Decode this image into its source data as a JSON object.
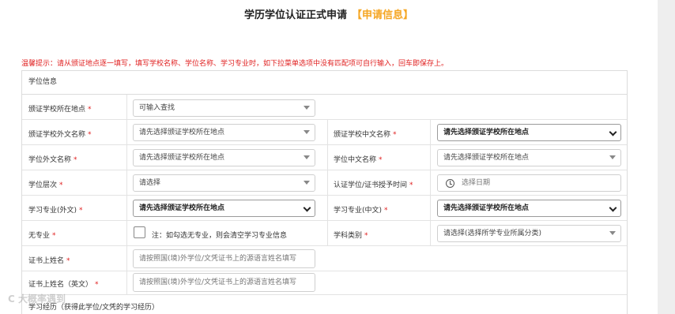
{
  "title": {
    "main": "学历学位认证正式申请",
    "sub": "【申请信息】"
  },
  "notice": "温馨提示：请从颁证地点逐一填写，填写学校名称、学位名称、学习专业时，如下拉菜单选项中没有匹配项可自行输入，回车即保存上。",
  "section": {
    "degree_info": "学位信息",
    "study_history": "学习经历（获得此学位/文凭的学习经历）"
  },
  "fields": {
    "school_location": {
      "label": "颁证学校所在地点",
      "required": "*",
      "value": "可输入查找"
    },
    "school_foreign_name": {
      "label": "颁证学校外文名称",
      "required": "*",
      "value": "请先选择颁证学校所在地点"
    },
    "school_chinese_name": {
      "label": "颁证学校中文名称",
      "required": "*",
      "value": "请先选择颁证学校所在地点"
    },
    "degree_foreign_name": {
      "label": "学位外文名称",
      "required": "*",
      "value": "请先选择颁证学校所在地点"
    },
    "degree_chinese_name": {
      "label": "学位中文名称",
      "required": "*",
      "value": "请先选择颁证学校所在地点"
    },
    "degree_level": {
      "label": "学位层次",
      "required": "*",
      "value": "请选择"
    },
    "award_time": {
      "label": "认证学位/证书授予时间",
      "required": "*",
      "placeholder": "选择日期"
    },
    "major_foreign": {
      "label": "学习专业(外文)",
      "required": "*",
      "value": "请先选择颁证学校所在地点"
    },
    "major_chinese": {
      "label": "学习专业(中文)",
      "required": "*",
      "value": "请先选择颁证学校所在地点"
    },
    "no_major": {
      "label": "无专业",
      "required": "*",
      "hint": "注：如勾选无专业，则会清空学习专业信息"
    },
    "discipline": {
      "label": "学科类别",
      "required": "*",
      "value": "请选择(选择所学专业所属分类)"
    },
    "cert_name": {
      "label": "证书上姓名",
      "required": "*",
      "placeholder": "请按照国(境)外学位/文凭证书上的源语言姓名填写"
    },
    "cert_name_en": {
      "label": "证书上姓名（英文）",
      "required": "*",
      "placeholder": "请按照国(境)外学位/文凭证书上的源语言姓名填写"
    }
  },
  "watermark": "C 大概率遇到"
}
